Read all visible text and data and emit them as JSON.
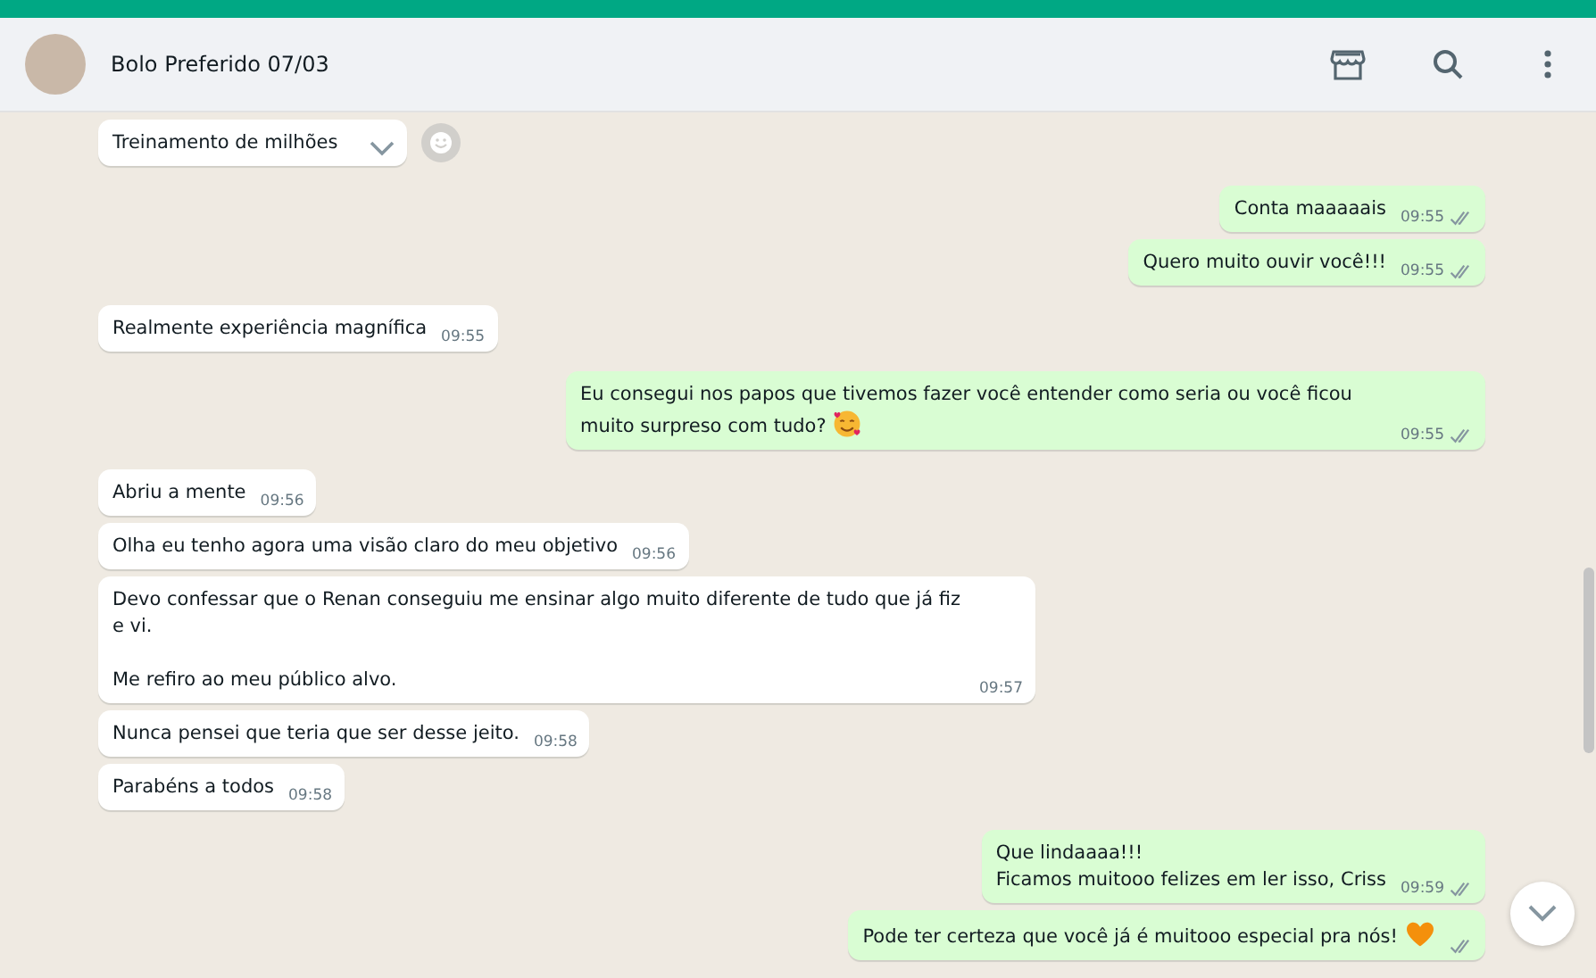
{
  "header": {
    "title": "Bolo Preferido 07/03"
  },
  "messages": [
    {
      "kind": "incoming",
      "text": "Treinamento de milhões",
      "hover": true
    },
    {
      "kind": "outgoing",
      "text": "Conta maaaaais",
      "time": "09:55",
      "read": false
    },
    {
      "kind": "outgoing",
      "text": "Quero muito ouvir você!!!",
      "time": "09:55",
      "read": false
    },
    {
      "kind": "incoming",
      "text": "Realmente experiência magnífica",
      "time": "09:55"
    },
    {
      "kind": "outgoing",
      "text": "Eu consegui nos papos que tivemos fazer você entender como seria ou você ficou muito surpreso com tudo?",
      "emoji": {
        "kind": "face"
      },
      "time": "09:55",
      "read": false
    },
    {
      "kind": "incoming",
      "text": "Abriu a mente",
      "time": "09:56"
    },
    {
      "kind": "incoming",
      "text": "Olha eu tenho agora uma visão claro do meu objetivo",
      "time": "09:56"
    },
    {
      "kind": "incoming",
      "text": "Devo confessar que o Renan conseguiu me ensinar algo muito diferente de tudo que já fiz e vi.\n\nMe refiro ao meu público alvo.",
      "time": "09:57"
    },
    {
      "kind": "incoming",
      "text": "Nunca pensei que teria que ser desse jeito.",
      "time": "09:58"
    },
    {
      "kind": "incoming",
      "text": "Parabéns a todos",
      "time": "09:58"
    },
    {
      "kind": "outgoing",
      "text": "Que lindaaaa!!!\nFicamos muitooo felizes em ler isso, Criss",
      "time": "09:59",
      "read": false
    },
    {
      "kind": "outgoing",
      "text": "Pode ter certeza que você já é muitooo especial pra nós!",
      "emoji": {
        "kind": "heart"
      },
      "read": false
    }
  ]
}
